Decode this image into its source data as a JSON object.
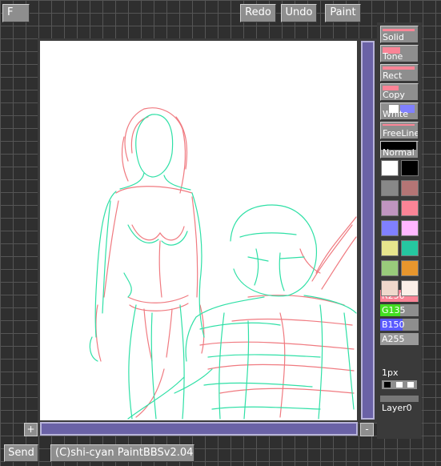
{
  "top_bar": {
    "f_label": "F",
    "redo_label": "Redo",
    "undo_label": "Undo",
    "paint_label": "Paint"
  },
  "canvas": {
    "plus_label": "+",
    "minus_label": "-"
  },
  "tools": {
    "solid": "Solid",
    "tone": "Tone",
    "rect": "Rect",
    "copy": "Copy",
    "white": "White",
    "freeline": "FreeLine",
    "normal": "Normal"
  },
  "palette": [
    [
      "#ffffff",
      "#000000"
    ],
    [
      "#888888",
      "#b47575"
    ],
    [
      "#c095c0",
      "#fa8496"
    ],
    [
      "#8080ff",
      "#ffb6ff"
    ],
    [
      "#e7e58d",
      "#25c7a0"
    ],
    [
      "#99cb7b",
      "#e7962d"
    ],
    [
      "#f0d8cc",
      "#fbefe8"
    ]
  ],
  "color_values": {
    "r": "R250",
    "g": "G135",
    "b": "B150",
    "a": "A255",
    "r_level": 0.98,
    "g_level": 0.53,
    "b_level": 0.59,
    "a_level": 1.0
  },
  "brush": {
    "size_label": "1px"
  },
  "layer": {
    "label": "Layer0"
  },
  "bottom": {
    "send_label": "Send",
    "credit": "(C)shi-cyan PaintBBSv2.04"
  },
  "colors": {
    "sketch_red": "#f07a80",
    "sketch_green": "#2fe0a6",
    "scroll": "#6a62a6"
  }
}
